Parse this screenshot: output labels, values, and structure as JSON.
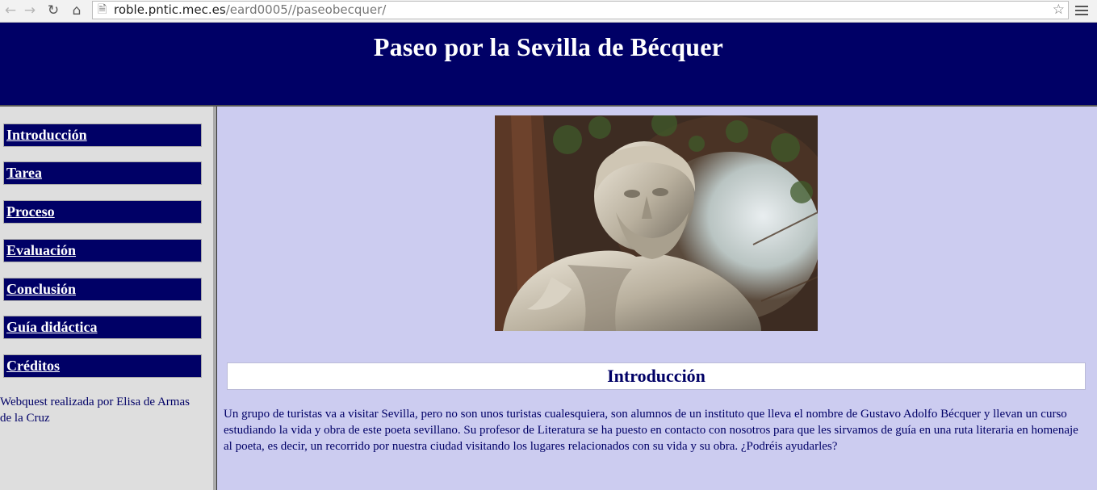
{
  "browser": {
    "url_host": "roble.pntic.mec.es",
    "url_path": "/eard0005//paseobecquer/"
  },
  "header": {
    "title": "Paseo por la Sevilla de Bécquer"
  },
  "sidebar": {
    "items": [
      {
        "label": "Introducción"
      },
      {
        "label": "Tarea"
      },
      {
        "label": "Proceso"
      },
      {
        "label": "Evaluación"
      },
      {
        "label": "Conclusión"
      },
      {
        "label": "Guía didáctica"
      },
      {
        "label": "Créditos"
      }
    ],
    "credit": "Webquest realizada por Elisa de Armas de la Cruz"
  },
  "main": {
    "section_title": "Introducción",
    "intro_text": "Un grupo de turistas va a visitar Sevilla, pero no son unos turistas cualesquiera, son alumnos de un instituto que lleva el nombre de Gustavo Adolfo Bécquer y llevan un curso estudiando la vida y obra de este poeta sevillano. Su profesor de Literatura se ha puesto en contacto con nosotros para que les sirvamos de guía en una ruta literaria en homenaje al poeta, es decir, un recorrido por nuestra ciudad visitando los lugares relacionados con su vida y su obra. ¿Podréis ayudarles?"
  },
  "colors": {
    "header_bg": "#000066",
    "main_bg": "#ccccf0",
    "sidebar_bg": "#dedede",
    "text": "#000066"
  }
}
